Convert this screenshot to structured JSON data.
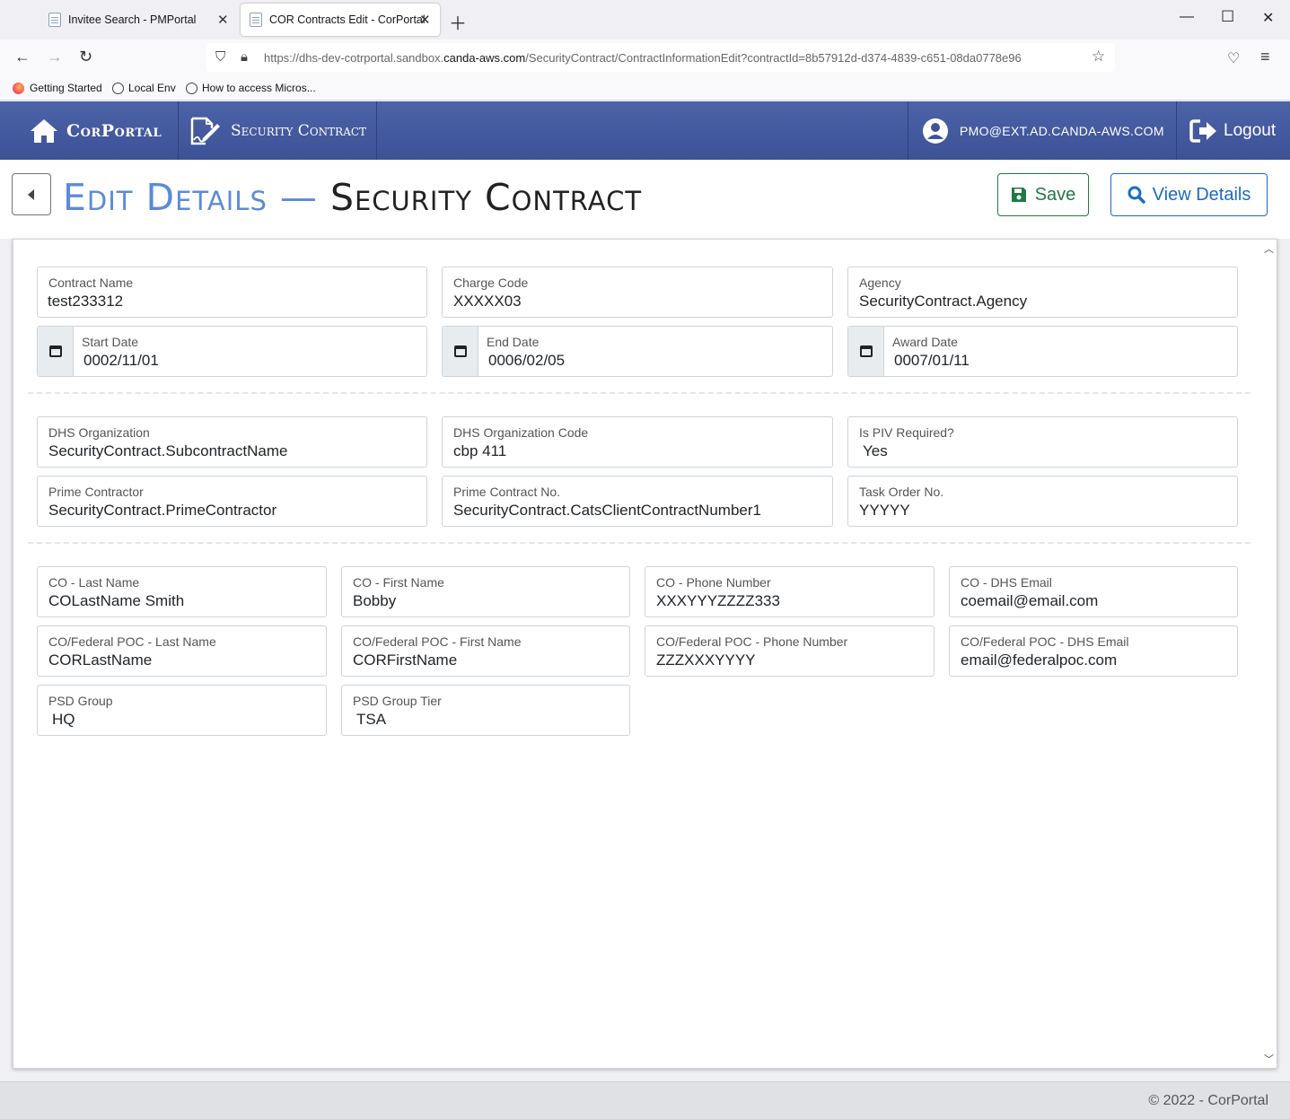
{
  "browser": {
    "tabs": [
      {
        "title": "Invitee Search - PMPortal",
        "active": false
      },
      {
        "title": "COR Contracts Edit - CorPortal",
        "active": true
      }
    ],
    "url_prefix": "https://dhs-dev-cotrportal.sandbox.",
    "url_domain": "canda-aws.com",
    "url_path": "/SecurityContract/ContractInformationEdit?contractId=8b57912d-d374-4839-c651-08da0778e96",
    "bookmarks": [
      "Getting Started",
      "Local Env",
      "How to access Micros..."
    ]
  },
  "header": {
    "brand": "CorPortal",
    "section": "Security Contract",
    "user": "PMO@EXT.AD.CANDA-AWS.COM",
    "logout": "Logout",
    "accent": "#3f5399"
  },
  "page": {
    "title_part1": "Edit Details",
    "title_dash": "—",
    "title_part2": "Security Contract",
    "save_label": "Save",
    "view_label": "View Details"
  },
  "fields": {
    "contract_name": {
      "label": "Contract Name",
      "value": "test233312"
    },
    "charge_code": {
      "label": "Charge Code",
      "value": "XXXXX03"
    },
    "agency": {
      "label": "Agency",
      "value": "SecurityContract.Agency"
    },
    "start_date": {
      "label": "Start Date",
      "value": "0002/11/01"
    },
    "end_date": {
      "label": "End Date",
      "value": "0006/02/05"
    },
    "award_date": {
      "label": "Award Date",
      "value": "0007/01/11"
    },
    "dhs_org": {
      "label": "DHS Organization",
      "value": "SecurityContract.SubcontractName"
    },
    "dhs_org_code": {
      "label": "DHS Organization Code",
      "value": "cbp 411"
    },
    "piv_required": {
      "label": "Is PIV Required?",
      "value": "Yes"
    },
    "prime_contractor": {
      "label": "Prime Contractor",
      "value": "SecurityContract.PrimeContractor"
    },
    "prime_contract_no": {
      "label": "Prime Contract No.",
      "value": "SecurityContract.CatsClientContractNumber1"
    },
    "task_order_no": {
      "label": "Task Order No.",
      "value": "YYYYY"
    },
    "co_last": {
      "label": "CO - Last Name",
      "value": "COLastName Smith"
    },
    "co_first": {
      "label": "CO - First Name",
      "value": "Bobby"
    },
    "co_phone": {
      "label": "CO - Phone Number",
      "value": "XXXYYYZZZZ333"
    },
    "co_email": {
      "label": "CO - DHS Email",
      "value": "coemail@email.com"
    },
    "poc_last": {
      "label": "CO/Federal POC - Last Name",
      "value": "CORLastName"
    },
    "poc_first": {
      "label": "CO/Federal POC - First Name",
      "value": "CORFirstName"
    },
    "poc_phone": {
      "label": "CO/Federal POC - Phone Number",
      "value": "ZZZXXXYYYY"
    },
    "poc_email": {
      "label": "CO/Federal POC - DHS Email",
      "value": "email@federalpoc.com"
    },
    "psd_group": {
      "label": "PSD Group",
      "value": "HQ"
    },
    "psd_tier": {
      "label": "PSD Group Tier",
      "value": "TSA"
    }
  },
  "footer": {
    "text": "© 2022 - CorPortal"
  }
}
